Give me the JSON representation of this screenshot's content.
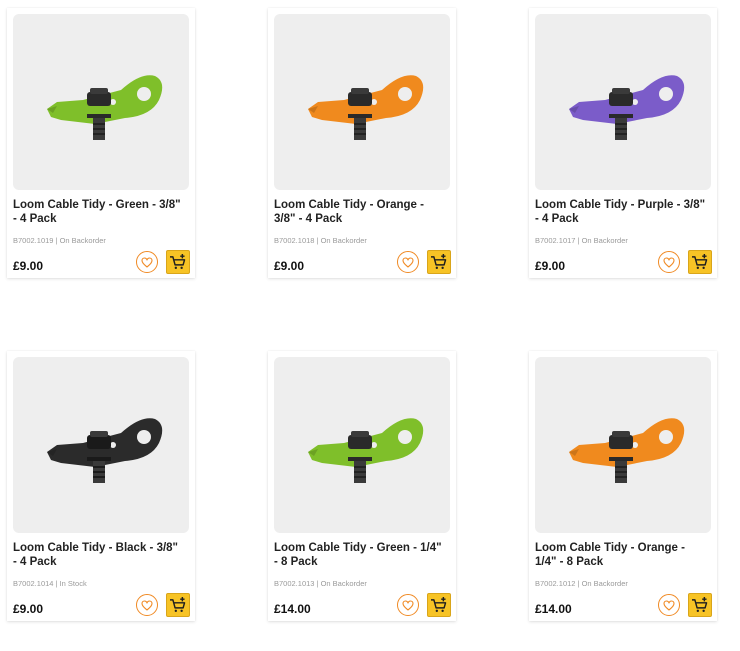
{
  "colors": {
    "accent": "#f08a24",
    "cart_button": "#f7c325",
    "image_bg": "#eeeeee"
  },
  "products": [
    {
      "title": "Loom Cable Tidy - Green - 3/8\"\n- 4 Pack",
      "sku": "B7002.1019",
      "availability": "On Backorder",
      "price": "£9.00",
      "strap_color": "#7fbf2a"
    },
    {
      "title": "Loom Cable Tidy - Orange -\n3/8\" - 4 Pack",
      "sku": "B7002.1018",
      "availability": "On Backorder",
      "price": "£9.00",
      "strap_color": "#f08a1e"
    },
    {
      "title": "Loom Cable Tidy - Purple - 3/8\"\n- 4 Pack",
      "sku": "B7002.1017",
      "availability": "On Backorder",
      "price": "£9.00",
      "strap_color": "#7b5cc9"
    },
    {
      "title": "Loom Cable Tidy - Black - 3/8\"\n- 4 Pack",
      "sku": "B7002.1014",
      "availability": "In Stock",
      "price": "£9.00",
      "strap_color": "#2b2b2b"
    },
    {
      "title": "Loom Cable Tidy - Green - 1/4\"\n- 8 Pack",
      "sku": "B7002.1013",
      "availability": "On Backorder",
      "price": "£14.00",
      "strap_color": "#7fbf2a"
    },
    {
      "title": "Loom Cable Tidy - Orange -\n1/4\" - 8 Pack",
      "sku": "B7002.1012",
      "availability": "On Backorder",
      "price": "£14.00",
      "strap_color": "#f08a1e"
    }
  ]
}
